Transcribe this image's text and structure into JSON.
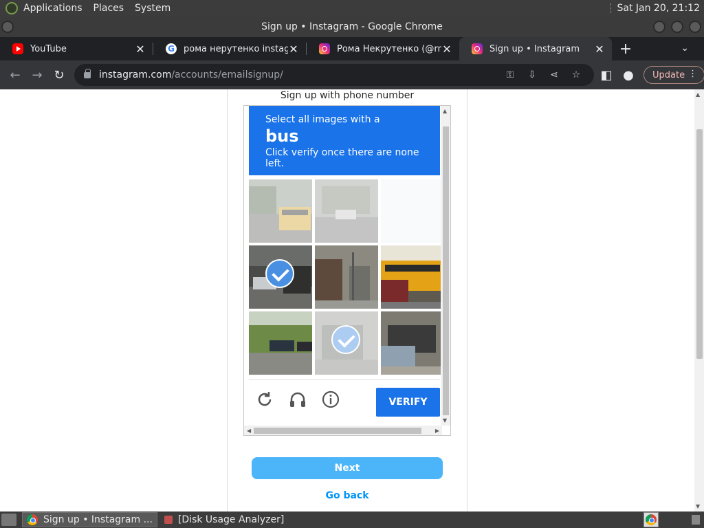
{
  "topbar": {
    "menus": [
      "Applications",
      "Places",
      "System"
    ],
    "clock": "Sat Jan 20, 21:12"
  },
  "window": {
    "title": "Sign up • Instagram - Google Chrome"
  },
  "tabs": [
    {
      "title": "YouTube",
      "icon": "youtube-icon",
      "active": false
    },
    {
      "title": "рома нерутенко instagram",
      "icon": "google-icon",
      "active": false
    },
    {
      "title": "Рома Некрутенко (@rnek",
      "icon": "instagram-icon",
      "active": false
    },
    {
      "title": "Sign up • Instagram",
      "icon": "instagram-icon",
      "active": true
    }
  ],
  "toolbar": {
    "url_host": "instagram.com",
    "url_path": "/accounts/emailsignup/",
    "update_label": "Update"
  },
  "page": {
    "heading": "Sign up with phone number",
    "next_label": "Next",
    "go_back_label": "Go back"
  },
  "captcha": {
    "instruction_line1": "Select all images with a",
    "target_word": "bus",
    "instruction_line3": "Click verify once there are none left.",
    "verify_label": "VERIFY",
    "header_color": "#1a73e8",
    "tiles": [
      {
        "selected": false,
        "faded": true,
        "blank": false
      },
      {
        "selected": false,
        "faded": true,
        "blank": false
      },
      {
        "selected": false,
        "faded": false,
        "blank": true
      },
      {
        "selected": true,
        "faded": false,
        "blank": false
      },
      {
        "selected": false,
        "faded": false,
        "blank": false
      },
      {
        "selected": false,
        "faded": false,
        "blank": false
      },
      {
        "selected": false,
        "faded": false,
        "blank": false
      },
      {
        "selected": true,
        "faded": true,
        "blank": false
      },
      {
        "selected": false,
        "faded": false,
        "blank": false
      }
    ]
  },
  "taskbar": {
    "tasks": [
      {
        "label": "Sign up • Instagram ...",
        "active": true
      },
      {
        "label": "[Disk Usage Analyzer]",
        "active": false
      }
    ]
  }
}
